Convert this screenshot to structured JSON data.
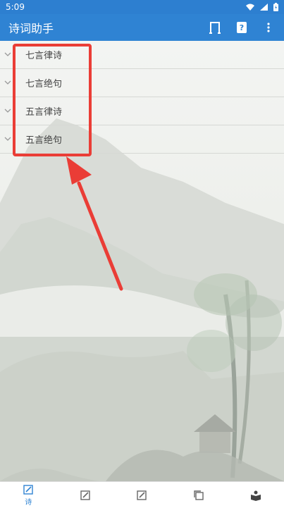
{
  "status": {
    "time": "5:09"
  },
  "header": {
    "title": "诗词助手"
  },
  "categories": [
    {
      "label": "七言律诗"
    },
    {
      "label": "七言绝句"
    },
    {
      "label": "五言律诗"
    },
    {
      "label": "五言绝句"
    }
  ],
  "bottom_nav": {
    "items": [
      {
        "label": "诗"
      }
    ]
  },
  "colors": {
    "primary": "#2f83d3",
    "highlight": "#ea3d36"
  }
}
